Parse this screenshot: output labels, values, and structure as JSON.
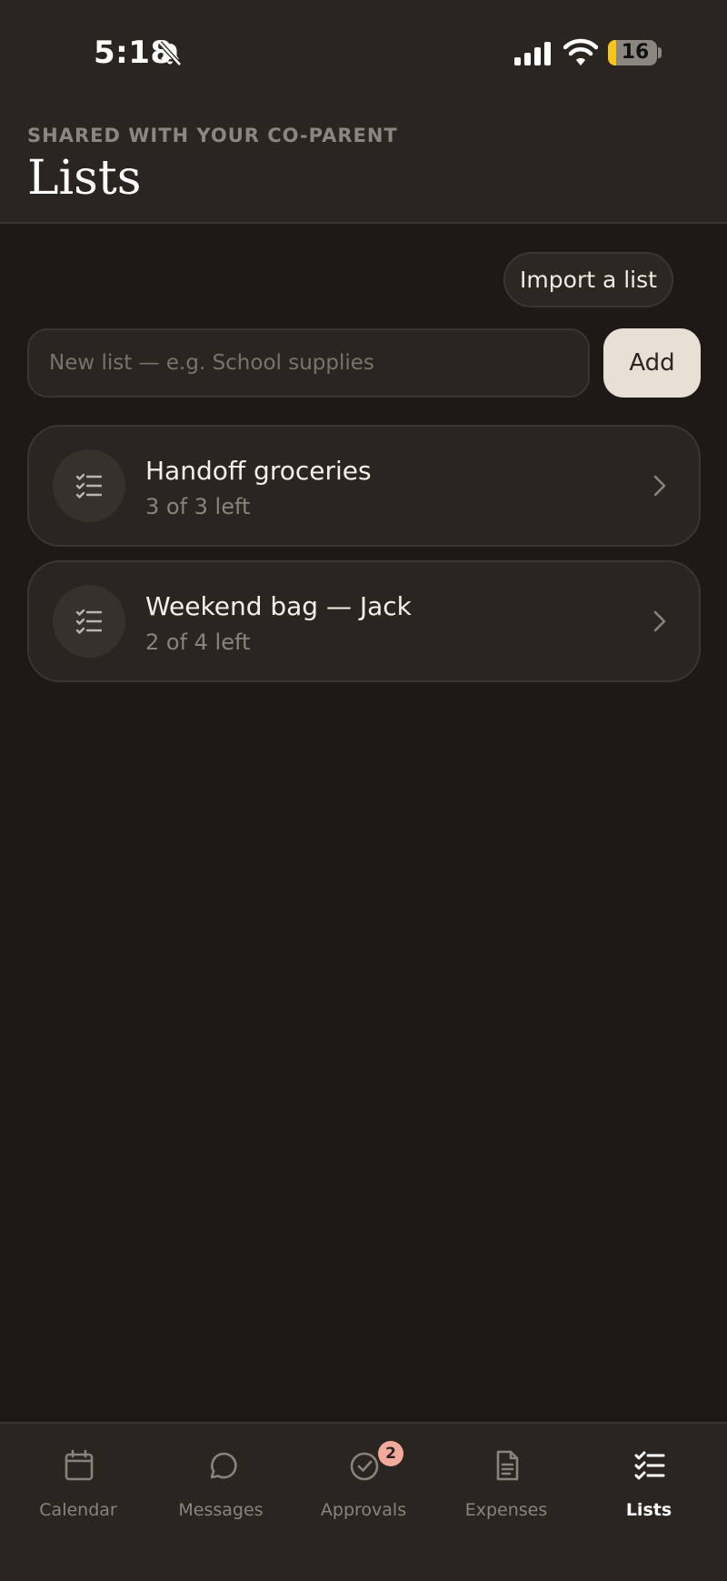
{
  "status_bar": {
    "time": "5:18",
    "battery_level": "16",
    "battery_fraction": 0.16
  },
  "header": {
    "eyebrow": "SHARED WITH YOUR CO-PARENT",
    "title": "Lists"
  },
  "controls": {
    "import_label": "Import a list",
    "new_list_placeholder": "New list — e.g. School supplies",
    "new_list_value": "",
    "add_label": "Add"
  },
  "lists": [
    {
      "title": "Handoff groceries",
      "subtitle": "3 of 3 left",
      "icon": "checklist-icon"
    },
    {
      "title": "Weekend bag — Jack",
      "subtitle": "2 of 4 left",
      "icon": "checklist-icon"
    }
  ],
  "tabs": [
    {
      "label": "Calendar",
      "icon": "calendar-icon",
      "active": false
    },
    {
      "label": "Messages",
      "icon": "chat-bubble-icon",
      "active": false
    },
    {
      "label": "Approvals",
      "icon": "check-circle-icon",
      "active": false,
      "badge": "2"
    },
    {
      "label": "Expenses",
      "icon": "document-icon",
      "active": false
    },
    {
      "label": "Lists",
      "icon": "checklist-icon",
      "active": true
    }
  ],
  "colors": {
    "background": "#1e1916",
    "surface": "#2a2521",
    "accent_button": "#e9e0d5",
    "badge": "#f3a99b",
    "battery_low": "#f5c518"
  }
}
